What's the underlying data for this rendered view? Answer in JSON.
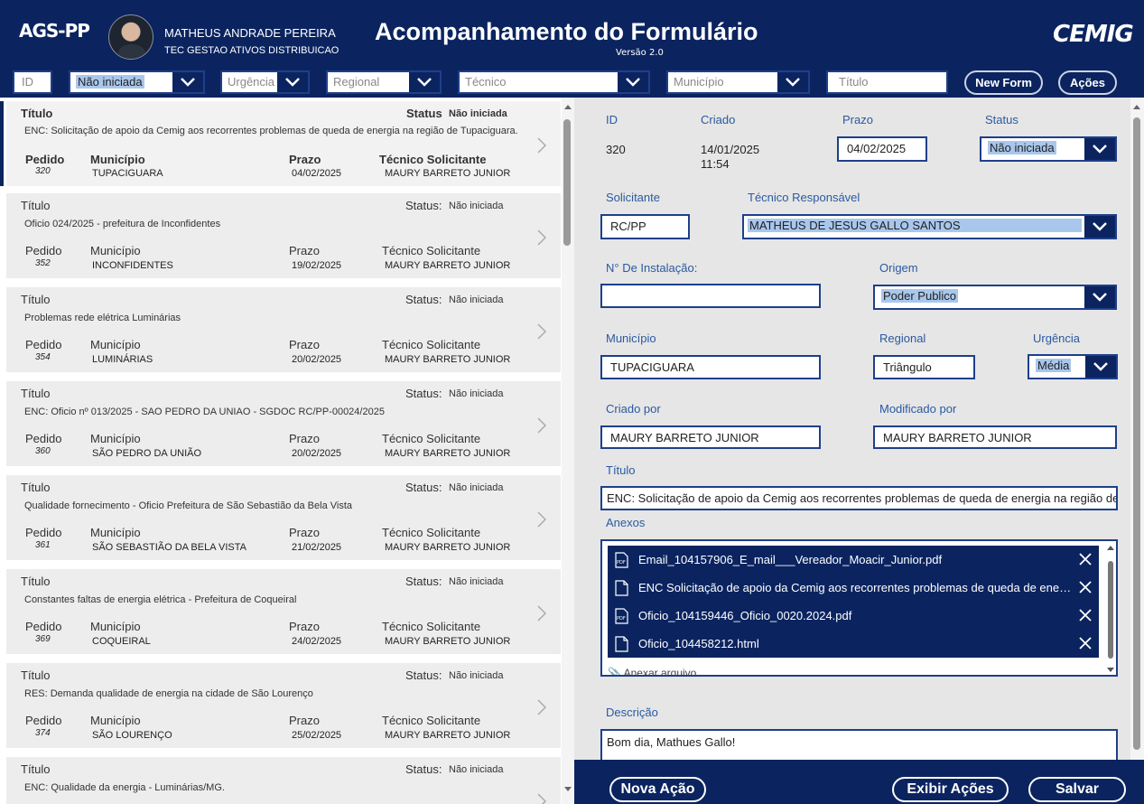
{
  "header": {
    "app_code": "AGS-PP",
    "user_name": "MATHEUS ANDRADE PEREIRA",
    "user_role": "TEC GESTAO ATIVOS DISTRIBUICAO",
    "title": "Acompanhamento do Formulário",
    "version": "Versão 2.0",
    "logo": "CEMIG"
  },
  "filters": {
    "id_placeholder": "ID",
    "status_value": "Não iniciada",
    "urgencia_placeholder": "Urgência",
    "regional_placeholder": "Regional",
    "tecnico_placeholder": "Técnico",
    "municipio_placeholder": "Município",
    "titulo_placeholder": "Título",
    "new_form_label": "New Form",
    "acoes_label": "Ações"
  },
  "list_labels": {
    "titulo": "Título",
    "status": "Status:",
    "pedido": "Pedido",
    "municipio": "Município",
    "prazo": "Prazo",
    "tecnico": "Técnico Solicitante"
  },
  "selected_labels": {
    "titulo": "Título",
    "status": "Status",
    "pedido": "Pedido",
    "municipio": "Município",
    "prazo": "Prazo",
    "tecnico": "Técnico Solicitante"
  },
  "items": [
    {
      "desc": "ENC: Solicitação de apoio da Cemig aos recorrentes problemas de queda de energia na região de Tupaciguara.",
      "status": "Não iniciada",
      "pedido": "320",
      "municipio": "TUPACIGUARA",
      "prazo": "04/02/2025",
      "tecnico": "MAURY BARRETO JUNIOR"
    },
    {
      "desc": "Oficio 024/2025 - prefeitura de Inconfidentes",
      "status": "Não iniciada",
      "pedido": "352",
      "municipio": "INCONFIDENTES",
      "prazo": "19/02/2025",
      "tecnico": "MAURY BARRETO JUNIOR"
    },
    {
      "desc": "Problemas rede elétrica Luminárias",
      "status": "Não iniciada",
      "pedido": "354",
      "municipio": "LUMINÁRIAS",
      "prazo": "20/02/2025",
      "tecnico": "MAURY BARRETO JUNIOR"
    },
    {
      "desc": "ENC: Oficio nº 013/2025 - SAO PEDRO DA UNIAO - SGDOC RC/PP-00024/2025",
      "status": "Não iniciada",
      "pedido": "360",
      "municipio": "SÃO PEDRO DA UNIÃO",
      "prazo": "20/02/2025",
      "tecnico": "MAURY BARRETO JUNIOR"
    },
    {
      "desc": "Qualidade fornecimento - Oficio Prefeitura de  São Sebastião da Bela Vista",
      "status": "Não iniciada",
      "pedido": "361",
      "municipio": "SÃO SEBASTIÃO DA BELA VISTA",
      "prazo": "21/02/2025",
      "tecnico": "MAURY BARRETO JUNIOR"
    },
    {
      "desc": "Constantes faltas de energia elétrica - Prefeitura de Coqueiral",
      "status": "Não iniciada",
      "pedido": "369",
      "municipio": "COQUEIRAL",
      "prazo": "24/02/2025",
      "tecnico": "MAURY BARRETO JUNIOR"
    },
    {
      "desc": "RES: Demanda qualidade de energia na cidade de São Lourenço",
      "status": "Não iniciada",
      "pedido": "374",
      "municipio": "SÃO LOURENÇO",
      "prazo": "25/02/2025",
      "tecnico": "MAURY BARRETO JUNIOR"
    },
    {
      "desc": "ENC: Qualidade da energia - Luminárias/MG.",
      "status": "Não iniciada",
      "pedido": "",
      "municipio": "",
      "prazo": "",
      "tecnico": ""
    }
  ],
  "detail": {
    "id_label": "ID",
    "id_value": "320",
    "criado_label": "Criado",
    "criado_date": "14/01/2025",
    "criado_time": "11:54",
    "prazo_label": "Prazo",
    "prazo_value": "04/02/2025",
    "status_label": "Status",
    "status_value": "Não iniciada",
    "solicitante_label": "Solicitante",
    "solicitante_value": "RC/PP",
    "tecnico_resp_label": "Técnico Responsável",
    "tecnico_resp_value": "MATHEUS DE JESUS GALLO SANTOS",
    "instalacao_label": "N° De Instalação:",
    "instalacao_value": "",
    "origem_label": "Origem",
    "origem_value": "Poder Publico",
    "municipio_label": "Município",
    "municipio_value": "TUPACIGUARA",
    "regional_label": "Regional",
    "regional_value": "Triângulo",
    "urgencia_label": "Urgência",
    "urgencia_value": "Média",
    "criado_por_label": "Criado por",
    "criado_por_value": "MAURY BARRETO JUNIOR",
    "modificado_por_label": "Modificado por",
    "modificado_por_value": "MAURY BARRETO JUNIOR",
    "titulo_label": "Título",
    "titulo_value": "ENC: Solicitação de apoio da Cemig aos recorrentes problemas de queda de energia na região de Tupaciguara.",
    "anexos_label": "Anexos",
    "attachments": [
      {
        "name": "Email_104157906_E_mail___Vereador_Moacir_Junior.pdf",
        "icon": "pdf-file-icon"
      },
      {
        "name": "ENC Solicitação de apoio da Cemig aos recorrentes problemas de queda de energia na região de Tupaciguara",
        "icon": "file-icon"
      },
      {
        "name": "Oficio_104159446_Oficio_0020.2024.pdf",
        "icon": "pdf-file-icon"
      },
      {
        "name": "Oficio_104458212.html",
        "icon": "file-icon"
      }
    ],
    "anexar_label": "Anexar arquivo",
    "descricao_label": "Descrição",
    "descricao_value": "Bom dia, Mathues Gallo!"
  },
  "footer": {
    "nova_acao": "Nova Ação",
    "exibir_acoes": "Exibir Ações",
    "salvar": "Salvar"
  }
}
